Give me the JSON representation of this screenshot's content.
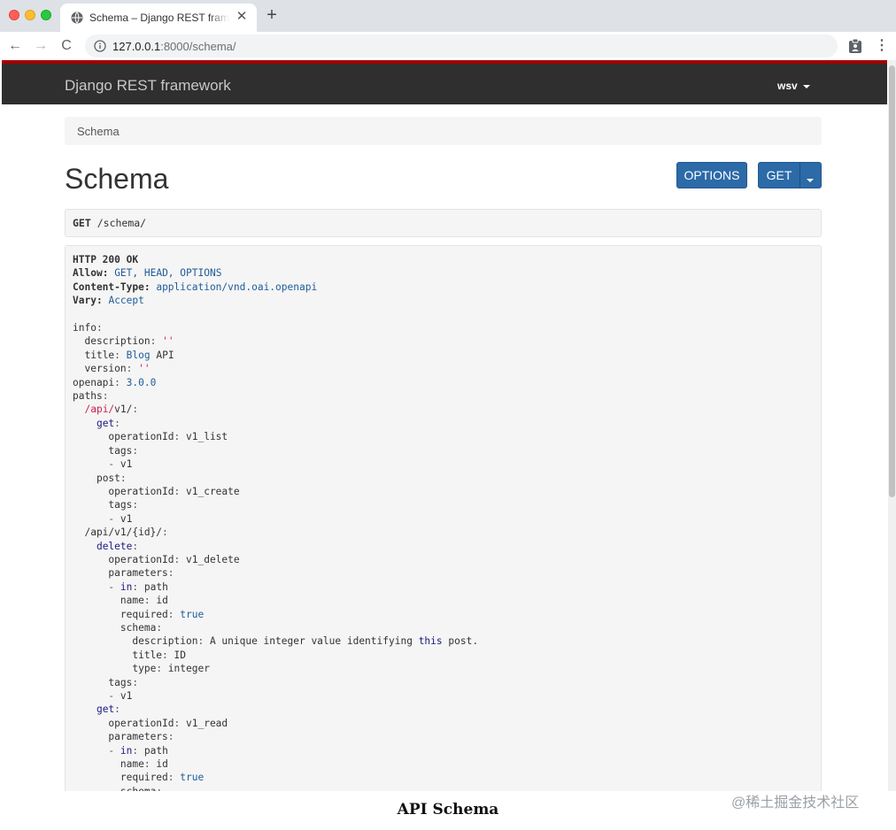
{
  "browser": {
    "tab_title": "Schema – Django REST framework",
    "tab_close": "✕",
    "new_tab": "+",
    "url_host": "127.0.0.1",
    "url_rest": ":8000/schema/"
  },
  "navbar": {
    "brand": "Django REST framework",
    "user": "wsv"
  },
  "breadcrumb": [
    "Schema"
  ],
  "page": {
    "title": "Schema",
    "options_button": "OPTIONS",
    "get_button": "GET"
  },
  "request": {
    "method": "GET",
    "path": "/schema/"
  },
  "response": {
    "status": "HTTP 200 OK",
    "headers": [
      {
        "name": "Allow",
        "value": "GET, HEAD, OPTIONS"
      },
      {
        "name": "Content-Type",
        "value": "application/vnd.oai.openapi"
      },
      {
        "name": "Vary",
        "value": "Accept"
      }
    ]
  },
  "caption": "API Schema",
  "watermark": "@稀土掘金技术社区"
}
